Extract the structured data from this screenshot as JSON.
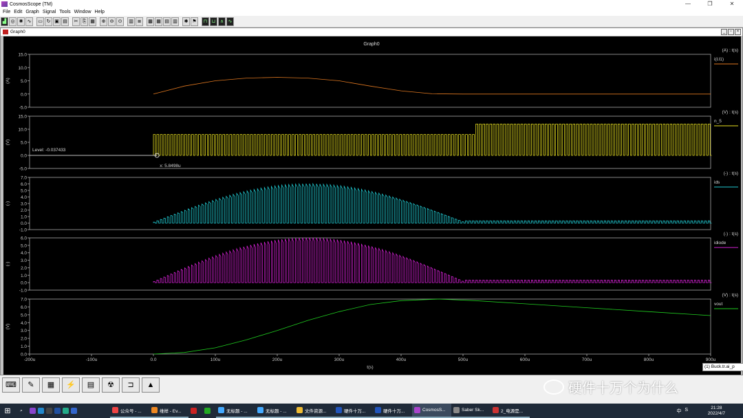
{
  "window": {
    "title": "CosmosScope (TM)"
  },
  "menu": [
    "File",
    "Edit",
    "Graph",
    "Signal",
    "Tools",
    "Window",
    "Help"
  ],
  "graph_window": {
    "title": "Graph0"
  },
  "graph": {
    "title": "Graph0",
    "xlabel": "t(s)",
    "x_ticks": [
      "-200u",
      "-100u",
      "0.0",
      "100u",
      "200u",
      "300u",
      "400u",
      "500u",
      "600u",
      "700u",
      "800u",
      "900u"
    ],
    "cursor": {
      "level_text": "Level: -0.037433",
      "x_text": "x: 5.8498u"
    }
  },
  "chart_data": [
    {
      "type": "line",
      "unit_label": "(A) : t(s)",
      "ylabel": "(A)",
      "series": [
        {
          "name": "i(l.l1)",
          "color": "#e07820",
          "values": [
            [
              0,
              0
            ],
            [
              50,
              3
            ],
            [
              100,
              5
            ],
            [
              150,
              6
            ],
            [
              200,
              6.3
            ],
            [
              250,
              6
            ],
            [
              300,
              5
            ],
            [
              350,
              3
            ],
            [
              400,
              1.2
            ],
            [
              450,
              0.1
            ],
            [
              500,
              0
            ],
            [
              600,
              0
            ],
            [
              900,
              0
            ]
          ]
        }
      ],
      "yticks": [
        "15.0",
        "10.0",
        "5.0",
        "0.0",
        "-5.0"
      ],
      "ylim": [
        -5,
        15
      ],
      "xlim": [
        -200,
        900
      ]
    },
    {
      "type": "line",
      "unit_label": "(V) : t(s)",
      "ylabel": "(V)",
      "series": [
        {
          "name": "n_5",
          "color": "#e8e020",
          "pattern": "square",
          "low": 0,
          "high": 8,
          "high_after_t": 12,
          "switch_t": 520
        }
      ],
      "yticks": [
        "15.0",
        "10.0",
        "5.0",
        "0.0",
        "-5.0"
      ],
      "ylim": [
        -5,
        15
      ],
      "xlim": [
        -200,
        900
      ]
    },
    {
      "type": "line",
      "unit_label": "(-) : t(s)",
      "ylabel": "(-)",
      "series": [
        {
          "name": "ids",
          "color": "#20c8d0",
          "pattern": "pulse_envelope",
          "peak": 6
        }
      ],
      "yticks": [
        "7.0",
        "6.0",
        "5.0",
        "4.0",
        "3.0",
        "2.0",
        "1.0",
        "0.0",
        "-1.0"
      ],
      "ylim": [
        -1,
        7
      ],
      "xlim": [
        -200,
        900
      ]
    },
    {
      "type": "line",
      "unit_label": "(-) : t(s)",
      "ylabel": "(-)",
      "series": [
        {
          "name": "idiode",
          "color": "#d020d0",
          "pattern": "pulse_envelope",
          "peak": 6
        }
      ],
      "yticks": [
        "6.0",
        "5.0",
        "4.0",
        "3.0",
        "2.0",
        "1.0",
        "0.0",
        "-1.0"
      ],
      "ylim": [
        -1,
        6
      ],
      "xlim": [
        -200,
        900
      ]
    },
    {
      "type": "line",
      "unit_label": "(V) : t(s)",
      "ylabel": "(V)",
      "series": [
        {
          "name": "vout",
          "color": "#20d020",
          "values": [
            [
              0,
              0
            ],
            [
              50,
              0.2
            ],
            [
              100,
              0.8
            ],
            [
              150,
              1.8
            ],
            [
              200,
              3
            ],
            [
              250,
              4.3
            ],
            [
              300,
              5.4
            ],
            [
              350,
              6.3
            ],
            [
              400,
              6.8
            ],
            [
              460,
              7
            ],
            [
              520,
              6.8
            ],
            [
              600,
              6.4
            ],
            [
              700,
              5.9
            ],
            [
              800,
              5.4
            ],
            [
              900,
              4.9
            ]
          ]
        }
      ],
      "yticks": [
        "7.0",
        "6.0",
        "5.0",
        "4.0",
        "3.0",
        "2.0",
        "1.0",
        "0.0"
      ],
      "ylim": [
        0,
        7
      ],
      "xlim": [
        -200,
        900
      ]
    }
  ],
  "popup": {
    "text": "(1) Buck.tr.ai_p"
  },
  "watermark": {
    "text": "硬件十万个为什么"
  },
  "taskbar": {
    "apps": [
      "公众号 - ...",
      "维样 - Ev...",
      "",
      "",
      "无标题 - ...",
      "无标题 - ...",
      "文件资源...",
      "硬件十万...",
      "硬件十万...",
      "CosmosS...",
      "Saber Sk...",
      "2_电源是..."
    ],
    "tray": [
      "中",
      "S"
    ],
    "time": "21:28",
    "date": "2022/4/7"
  }
}
